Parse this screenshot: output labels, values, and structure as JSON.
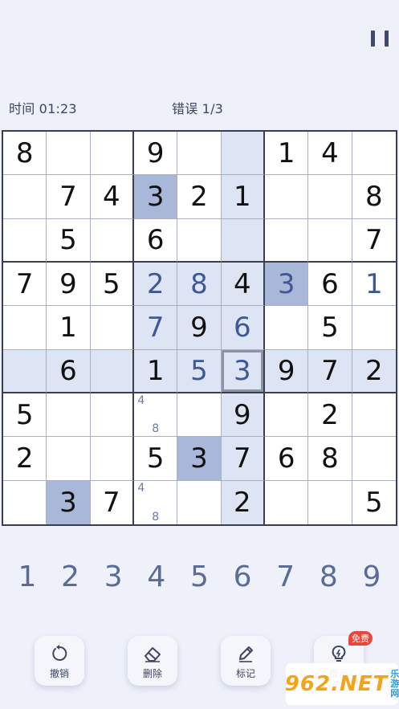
{
  "header": {
    "time_label": "时间 01:23",
    "mistakes_label": "错误 1/3"
  },
  "board": {
    "cells": [
      [
        {
          "v": "8",
          "t": "given"
        },
        {
          "v": "",
          "t": "empty"
        },
        {
          "v": "",
          "t": "empty"
        },
        {
          "v": "9",
          "t": "given"
        },
        {
          "v": "",
          "t": "empty"
        },
        {
          "v": "",
          "t": "empty",
          "h": "light"
        },
        {
          "v": "1",
          "t": "given"
        },
        {
          "v": "4",
          "t": "given"
        },
        {
          "v": "",
          "t": "empty"
        }
      ],
      [
        {
          "v": "",
          "t": "empty"
        },
        {
          "v": "7",
          "t": "given"
        },
        {
          "v": "4",
          "t": "given"
        },
        {
          "v": "3",
          "t": "given",
          "h": "dark"
        },
        {
          "v": "2",
          "t": "given"
        },
        {
          "v": "1",
          "t": "given",
          "h": "light"
        },
        {
          "v": "",
          "t": "empty"
        },
        {
          "v": "",
          "t": "empty"
        },
        {
          "v": "8",
          "t": "given"
        }
      ],
      [
        {
          "v": "",
          "t": "empty"
        },
        {
          "v": "5",
          "t": "given"
        },
        {
          "v": "",
          "t": "empty"
        },
        {
          "v": "6",
          "t": "given"
        },
        {
          "v": "",
          "t": "empty"
        },
        {
          "v": "",
          "t": "empty",
          "h": "light"
        },
        {
          "v": "",
          "t": "empty"
        },
        {
          "v": "",
          "t": "empty"
        },
        {
          "v": "7",
          "t": "given"
        }
      ],
      [
        {
          "v": "7",
          "t": "given"
        },
        {
          "v": "9",
          "t": "given"
        },
        {
          "v": "5",
          "t": "given"
        },
        {
          "v": "2",
          "t": "user",
          "h": "light"
        },
        {
          "v": "8",
          "t": "user",
          "h": "light"
        },
        {
          "v": "4",
          "t": "given",
          "h": "light"
        },
        {
          "v": "3",
          "t": "user",
          "h": "dark"
        },
        {
          "v": "6",
          "t": "given"
        },
        {
          "v": "1",
          "t": "user"
        }
      ],
      [
        {
          "v": "",
          "t": "empty"
        },
        {
          "v": "1",
          "t": "given"
        },
        {
          "v": "",
          "t": "empty"
        },
        {
          "v": "7",
          "t": "user",
          "h": "light"
        },
        {
          "v": "9",
          "t": "given",
          "h": "light"
        },
        {
          "v": "6",
          "t": "user",
          "h": "light"
        },
        {
          "v": "",
          "t": "empty"
        },
        {
          "v": "5",
          "t": "given"
        },
        {
          "v": "",
          "t": "empty"
        }
      ],
      [
        {
          "v": "",
          "t": "empty",
          "h": "light"
        },
        {
          "v": "6",
          "t": "given",
          "h": "light"
        },
        {
          "v": "",
          "t": "empty",
          "h": "light"
        },
        {
          "v": "1",
          "t": "given",
          "h": "light"
        },
        {
          "v": "5",
          "t": "user",
          "h": "light"
        },
        {
          "v": "3",
          "t": "user",
          "h": "selected"
        },
        {
          "v": "9",
          "t": "given",
          "h": "light"
        },
        {
          "v": "7",
          "t": "given",
          "h": "light"
        },
        {
          "v": "2",
          "t": "given",
          "h": "light"
        }
      ],
      [
        {
          "v": "5",
          "t": "given"
        },
        {
          "v": "",
          "t": "empty"
        },
        {
          "v": "",
          "t": "empty"
        },
        {
          "v": "",
          "t": "notes",
          "n": [
            "4",
            "",
            "",
            "",
            "",
            "",
            "",
            "8",
            ""
          ]
        },
        {
          "v": "",
          "t": "empty"
        },
        {
          "v": "9",
          "t": "given",
          "h": "light"
        },
        {
          "v": "",
          "t": "empty"
        },
        {
          "v": "2",
          "t": "given"
        },
        {
          "v": "",
          "t": "empty"
        }
      ],
      [
        {
          "v": "2",
          "t": "given"
        },
        {
          "v": "",
          "t": "empty"
        },
        {
          "v": "",
          "t": "empty"
        },
        {
          "v": "5",
          "t": "given"
        },
        {
          "v": "3",
          "t": "given",
          "h": "dark"
        },
        {
          "v": "7",
          "t": "given",
          "h": "light"
        },
        {
          "v": "6",
          "t": "given"
        },
        {
          "v": "8",
          "t": "given"
        },
        {
          "v": "",
          "t": "empty"
        }
      ],
      [
        {
          "v": "",
          "t": "empty"
        },
        {
          "v": "3",
          "t": "given",
          "h": "dark"
        },
        {
          "v": "7",
          "t": "given"
        },
        {
          "v": "",
          "t": "notes",
          "n": [
            "4",
            "",
            "",
            "",
            "",
            "",
            "",
            "8",
            ""
          ]
        },
        {
          "v": "",
          "t": "empty"
        },
        {
          "v": "2",
          "t": "given",
          "h": "light"
        },
        {
          "v": "",
          "t": "empty"
        },
        {
          "v": "",
          "t": "empty"
        },
        {
          "v": "5",
          "t": "given"
        }
      ]
    ]
  },
  "numpad": [
    "1",
    "2",
    "3",
    "4",
    "5",
    "6",
    "7",
    "8",
    "9"
  ],
  "tools": {
    "undo": "撤销",
    "erase": "删除",
    "notes": "标记",
    "hint": "提示",
    "hint_badge": "免费"
  },
  "watermark": {
    "text": "962.NET",
    "sub": "乐游网"
  },
  "colors": {
    "background": "#eef1fa",
    "highlight_light": "#dde5f4",
    "highlight_dark": "#a9b8d8",
    "user_digit": "#3e5894",
    "numpad_digit": "#5a6b96",
    "badge": "#e8473c"
  }
}
